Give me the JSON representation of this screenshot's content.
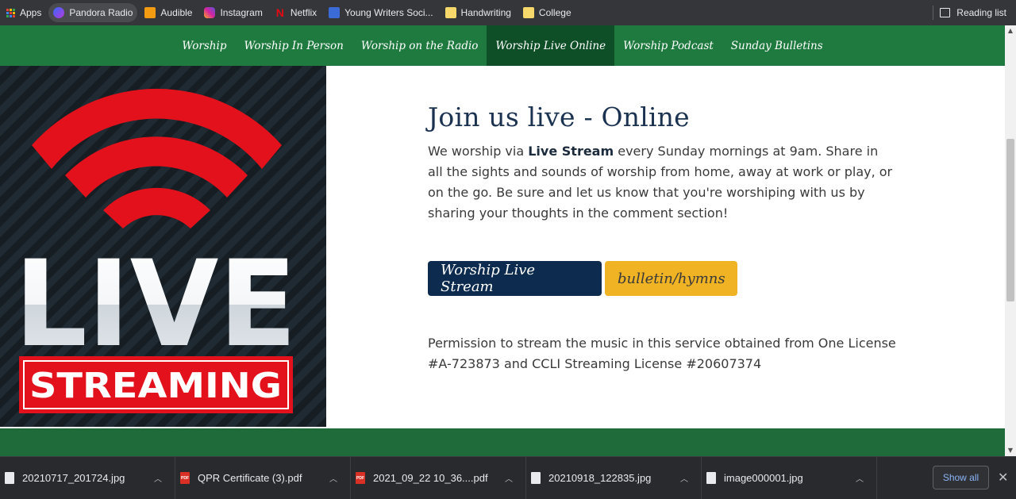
{
  "bookmarks": {
    "items": [
      {
        "label": "Apps",
        "icon": "apps-grid-icon"
      },
      {
        "label": "Pandora Radio",
        "icon": "pandora-icon",
        "color": "#7b3fe4"
      },
      {
        "label": "Audible",
        "icon": "audible-icon",
        "color": "#f39c12"
      },
      {
        "label": "Instagram",
        "icon": "instagram-icon",
        "color": "#d6249f"
      },
      {
        "label": "Netflix",
        "icon": "netflix-icon",
        "color": "#e50914"
      },
      {
        "label": "Young Writers Soci...",
        "icon": "young-writers-icon",
        "color": "#3b6bd6"
      },
      {
        "label": "Handwriting",
        "icon": "folder-icon",
        "color": "#f6d86b"
      },
      {
        "label": "College",
        "icon": "folder-icon",
        "color": "#f6d86b"
      }
    ],
    "reading_list": "Reading list"
  },
  "nav": {
    "items": [
      {
        "label": "Worship"
      },
      {
        "label": "Worship In Person"
      },
      {
        "label": "Worship on the Radio"
      },
      {
        "label": "Worship Live Online",
        "current": true
      },
      {
        "label": "Worship Podcast"
      },
      {
        "label": "Sunday Bulletins"
      }
    ]
  },
  "hero": {
    "live": "LIVE",
    "streaming": "STREAMING"
  },
  "content": {
    "heading": "Join us live - Online",
    "para_before": "We worship via ",
    "para_bold": "Live Stream",
    "para_after": " every Sunday mornings at 9am.  Share in all the sights and sounds of worship from home, away at work or play, or on the go.  Be sure and let us know that you're worshiping with us by sharing your thoughts in the comment section!",
    "button_primary": "Worship Live Stream",
    "button_secondary": "bulletin/hymns",
    "permission": "Permission to stream the music in this service obtained from One License #A-723873 and CCLI Streaming License #20607374"
  },
  "downloads": {
    "items": [
      {
        "name": "20210717_201724.jpg",
        "type": "img"
      },
      {
        "name": "QPR Certificate (3).pdf",
        "type": "pdf"
      },
      {
        "name": "2021_09_22 10_36....pdf",
        "type": "pdf"
      },
      {
        "name": "20210918_122835.jpg",
        "type": "img"
      },
      {
        "name": "image000001.jpg",
        "type": "img"
      }
    ],
    "show_all": "Show all"
  },
  "colors": {
    "nav_green": "#1f7a3f",
    "nav_current": "#0f4f28",
    "primary_button": "#0c2b4e",
    "secondary_button": "#f0b323",
    "heading": "#1b3350"
  }
}
